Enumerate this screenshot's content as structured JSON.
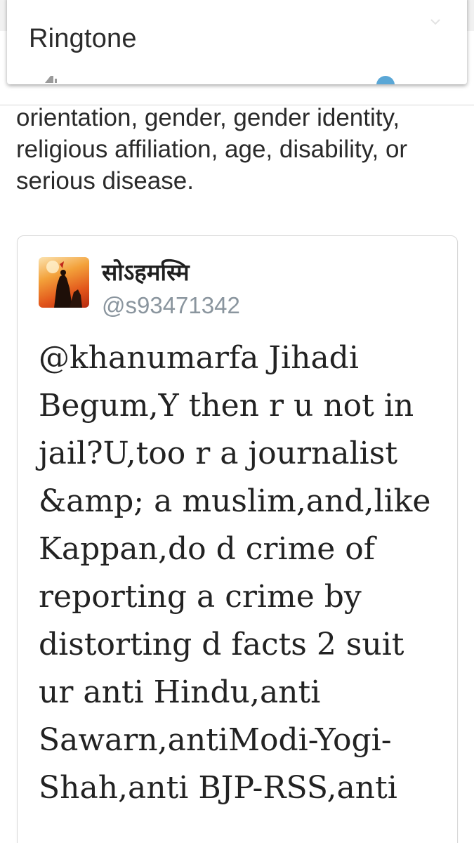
{
  "ringtone_dialog": {
    "title": "Ringtone",
    "speaker_icon": "speaker-icon",
    "chevron_icon": "chevron-down-icon",
    "slider_color": "#5aa7d6"
  },
  "policy_text": "orientation, gender, gender identity, religious affiliation, age, disability, or serious disease.",
  "tweet": {
    "author_name": "सोऽहमस्मि",
    "author_handle": "@s93471342",
    "avatar_icon": "avatar-image",
    "text": "@khanumarfa Jihadi Begum,Y then r u not in jail?U,too r a journalist &amp; a muslim,and,like Kappan,do d crime of reporting a crime by distorting d facts 2 suit ur anti Hindu,anti Sawarn,antiModi-Yogi-Shah,anti BJP-RSS,anti"
  },
  "colors": {
    "handle": "#8a959e",
    "card_border": "#d9d9d9",
    "text": "#222222"
  }
}
